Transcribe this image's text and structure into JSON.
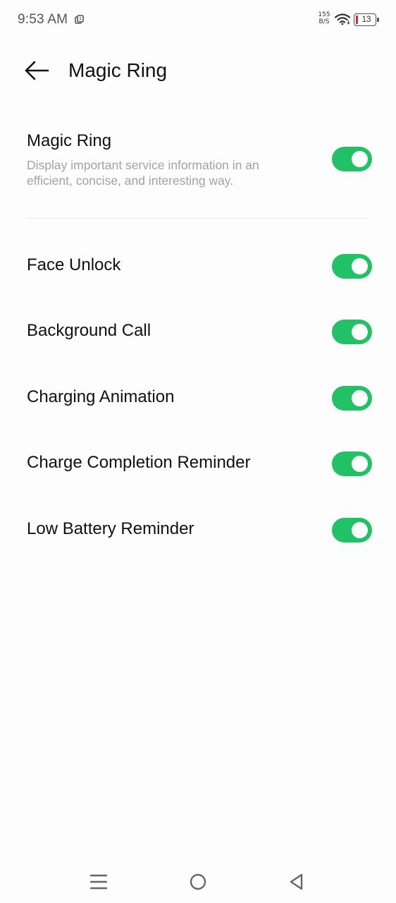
{
  "status_bar": {
    "time": "9:53 AM",
    "net_speed_value": "155",
    "net_speed_unit": "B/S",
    "battery_level": "13",
    "battery_color": "#e0242a"
  },
  "header": {
    "title": "Magic Ring",
    "back_icon": "arrow-left-icon"
  },
  "main_setting": {
    "title": "Magic Ring",
    "description": "Display important service information in an efficient, concise, and interesting way.",
    "enabled": true
  },
  "settings": [
    {
      "label": "Face Unlock",
      "enabled": true
    },
    {
      "label": "Background Call",
      "enabled": true
    },
    {
      "label": "Charging Animation",
      "enabled": true
    },
    {
      "label": "Charge Completion Reminder",
      "enabled": true
    },
    {
      "label": "Low Battery Reminder",
      "enabled": true
    }
  ],
  "nav_bar": {
    "icons": [
      "menu-icon",
      "home-circle-icon",
      "back-triangle-icon"
    ]
  },
  "colors": {
    "toggle_on": "#21c166",
    "description_text": "#a2a2a2",
    "background": "#fdfdfd"
  }
}
